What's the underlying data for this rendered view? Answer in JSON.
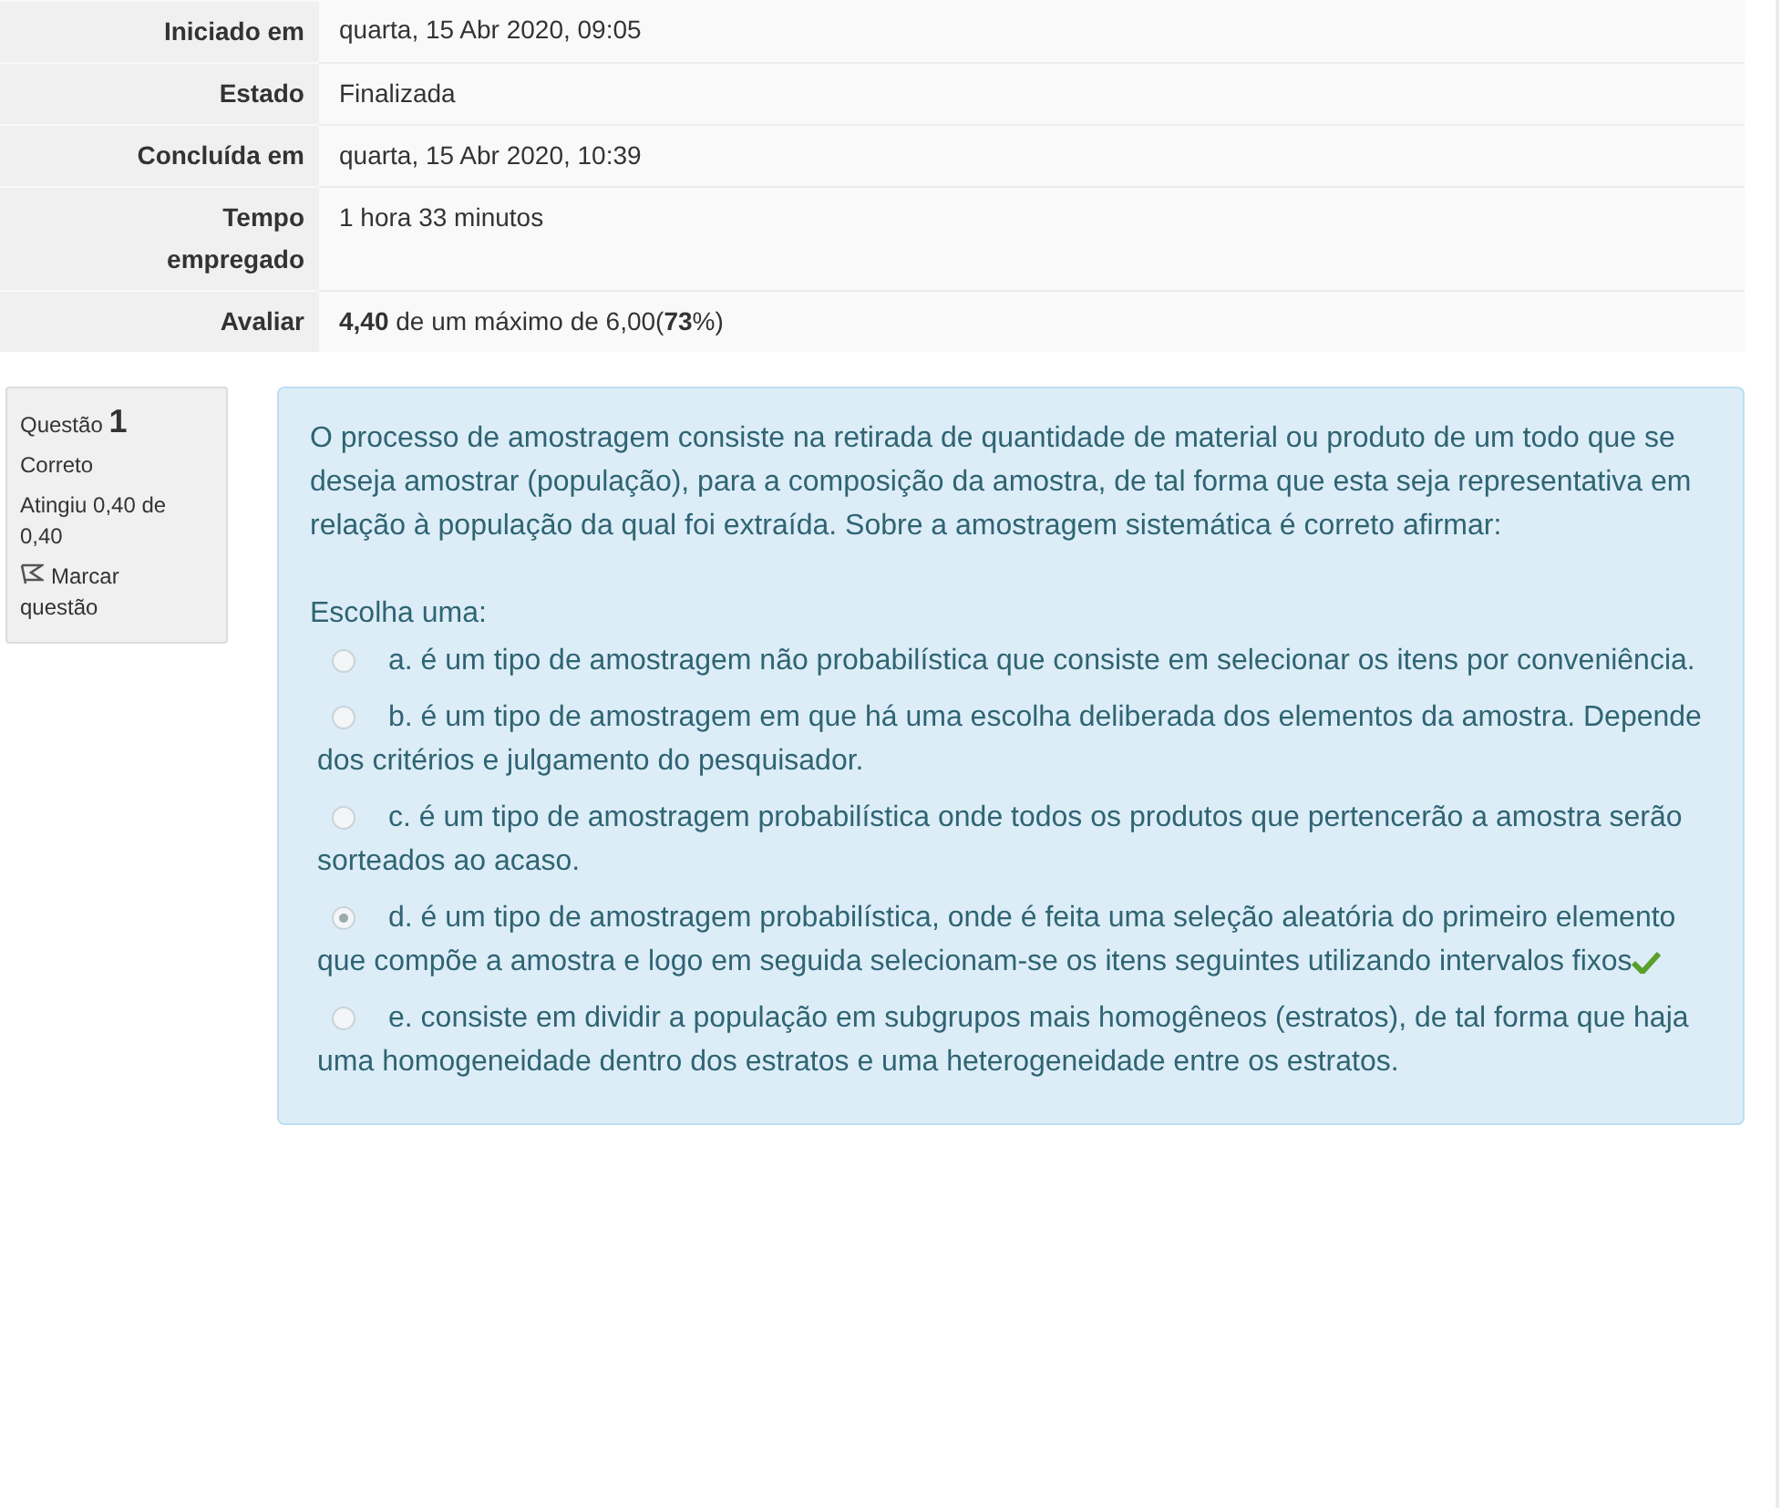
{
  "summary": [
    {
      "label": "Iniciado em",
      "value": "quarta, 15 Abr 2020, 09:05"
    },
    {
      "label": "Estado",
      "value": "Finalizada"
    },
    {
      "label": "Concluída em",
      "value": "quarta, 15 Abr 2020, 10:39"
    },
    {
      "label": "Tempo empregado",
      "value": "1 hora 33 minutos"
    },
    {
      "label": "Avaliar",
      "value": "**4,40** de um máximo de 6,00(**73**%)"
    }
  ],
  "info": {
    "title": "Questão",
    "number": "1",
    "state": "Correto",
    "grade": "Atingiu 0,40 de 0,40",
    "flag": "Marcar questão"
  },
  "question": {
    "text": "O processo de amostragem consiste na retirada de quantidade de material ou produto de um todo que se deseja amostrar (população), para a composição da amostra, de tal forma que esta seja representativa em relação à população da qual foi extraída. Sobre a amostragem sistemática é correto afirmar:",
    "prompt": "Escolha uma:",
    "options": [
      {
        "letter": "a.",
        "text": "é um tipo de amostragem não probabilística que consiste em selecionar os itens por conveniência.",
        "selected": false,
        "correct": false
      },
      {
        "letter": "b.",
        "text": "é um tipo de amostragem em que há uma escolha deliberada dos elementos da amostra. Depende dos critérios e julgamento do pesquisador.",
        "selected": false,
        "correct": false
      },
      {
        "letter": "c.",
        "text": "é um tipo de amostragem probabilística onde todos os produtos que pertencerão a amostra serão sorteados ao acaso.",
        "selected": false,
        "correct": false
      },
      {
        "letter": "d.",
        "text": "é um tipo de amostragem probabilística, onde é feita uma seleção aleatória do primeiro elemento que compõe a amostra e logo em seguida  selecionam-se os itens seguintes utilizando intervalos fixos",
        "selected": true,
        "correct": true
      },
      {
        "letter": "e.",
        "text": "consiste em dividir a população em subgrupos mais homogêneos (estratos), de tal forma que haja uma homogeneidade dentro dos estratos e uma heterogeneidade entre os estratos.",
        "selected": false,
        "correct": false
      }
    ]
  }
}
